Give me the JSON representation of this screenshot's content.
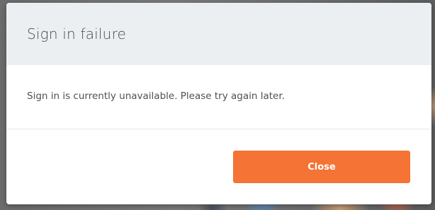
{
  "dialog": {
    "title": "Sign in failure",
    "message": "Sign in is currently unavailable. Please try again later.",
    "close_label": "Close"
  },
  "colors": {
    "header_bg": "#eceff1",
    "accent": "#f47335",
    "text": "#505050"
  }
}
